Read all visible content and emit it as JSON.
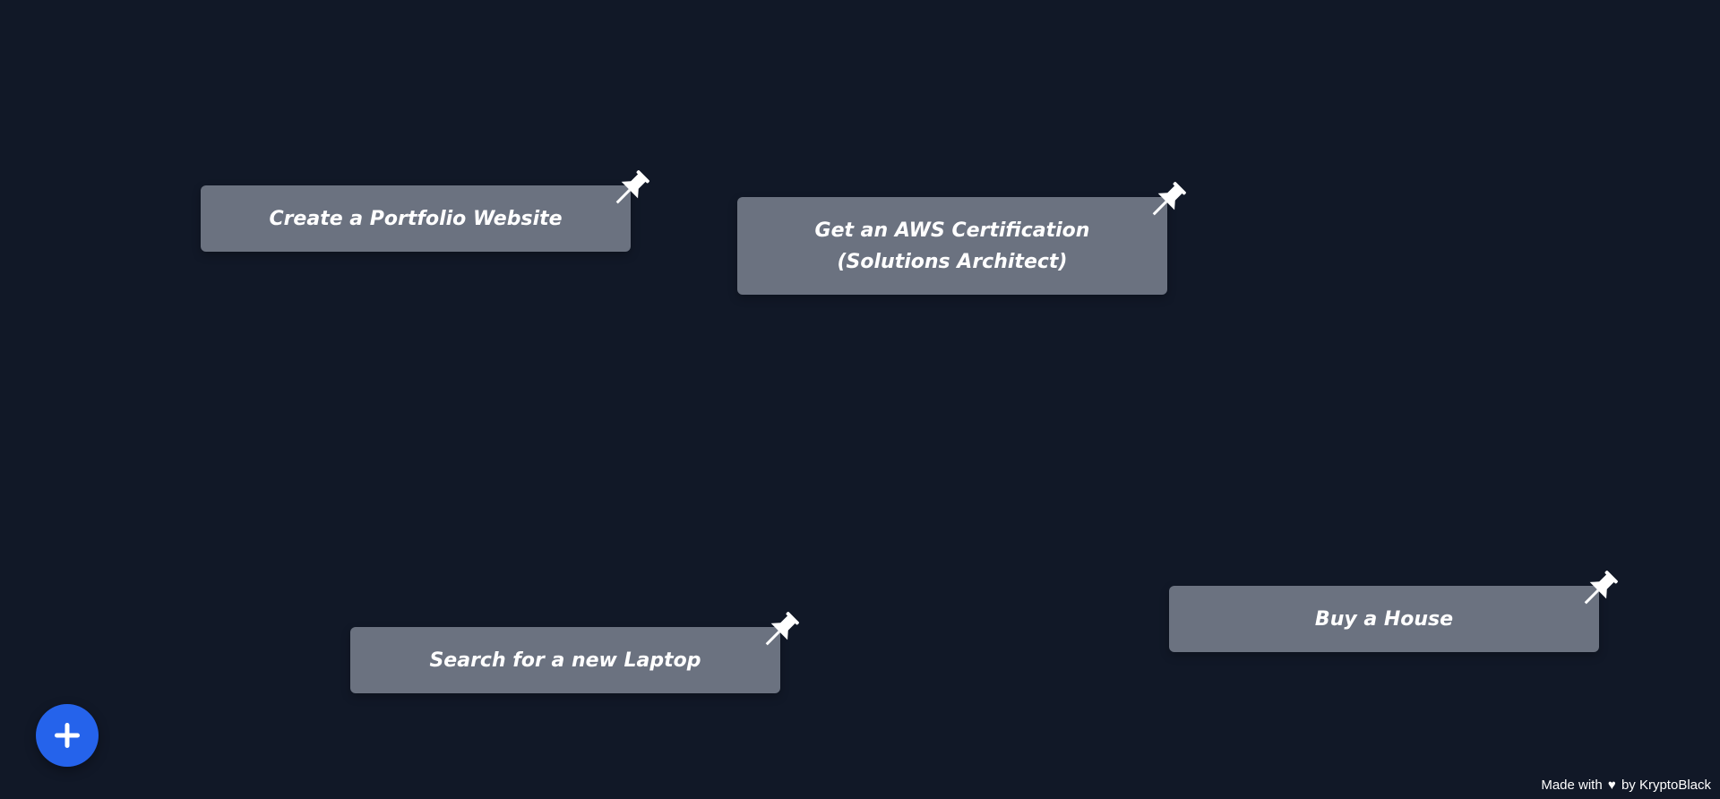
{
  "notes": [
    {
      "text": "Create a Portfolio Website",
      "icon": "pushpin-icon"
    },
    {
      "text": "Get an AWS Certification (Solutions Architect)",
      "icon": "pushpin-icon"
    },
    {
      "text": "Search for a new Laptop",
      "icon": "pushpin-icon"
    },
    {
      "text": "Buy a House",
      "icon": "pushpin-icon"
    }
  ],
  "add_button": {
    "icon": "plus-icon",
    "color": "#2563eb"
  },
  "footer": {
    "prefix": "Made with",
    "heart": "♥",
    "suffix": "by KryptoBlack"
  },
  "colors": {
    "background": "#111827",
    "note": "#6b7280",
    "text": "#ffffff"
  }
}
